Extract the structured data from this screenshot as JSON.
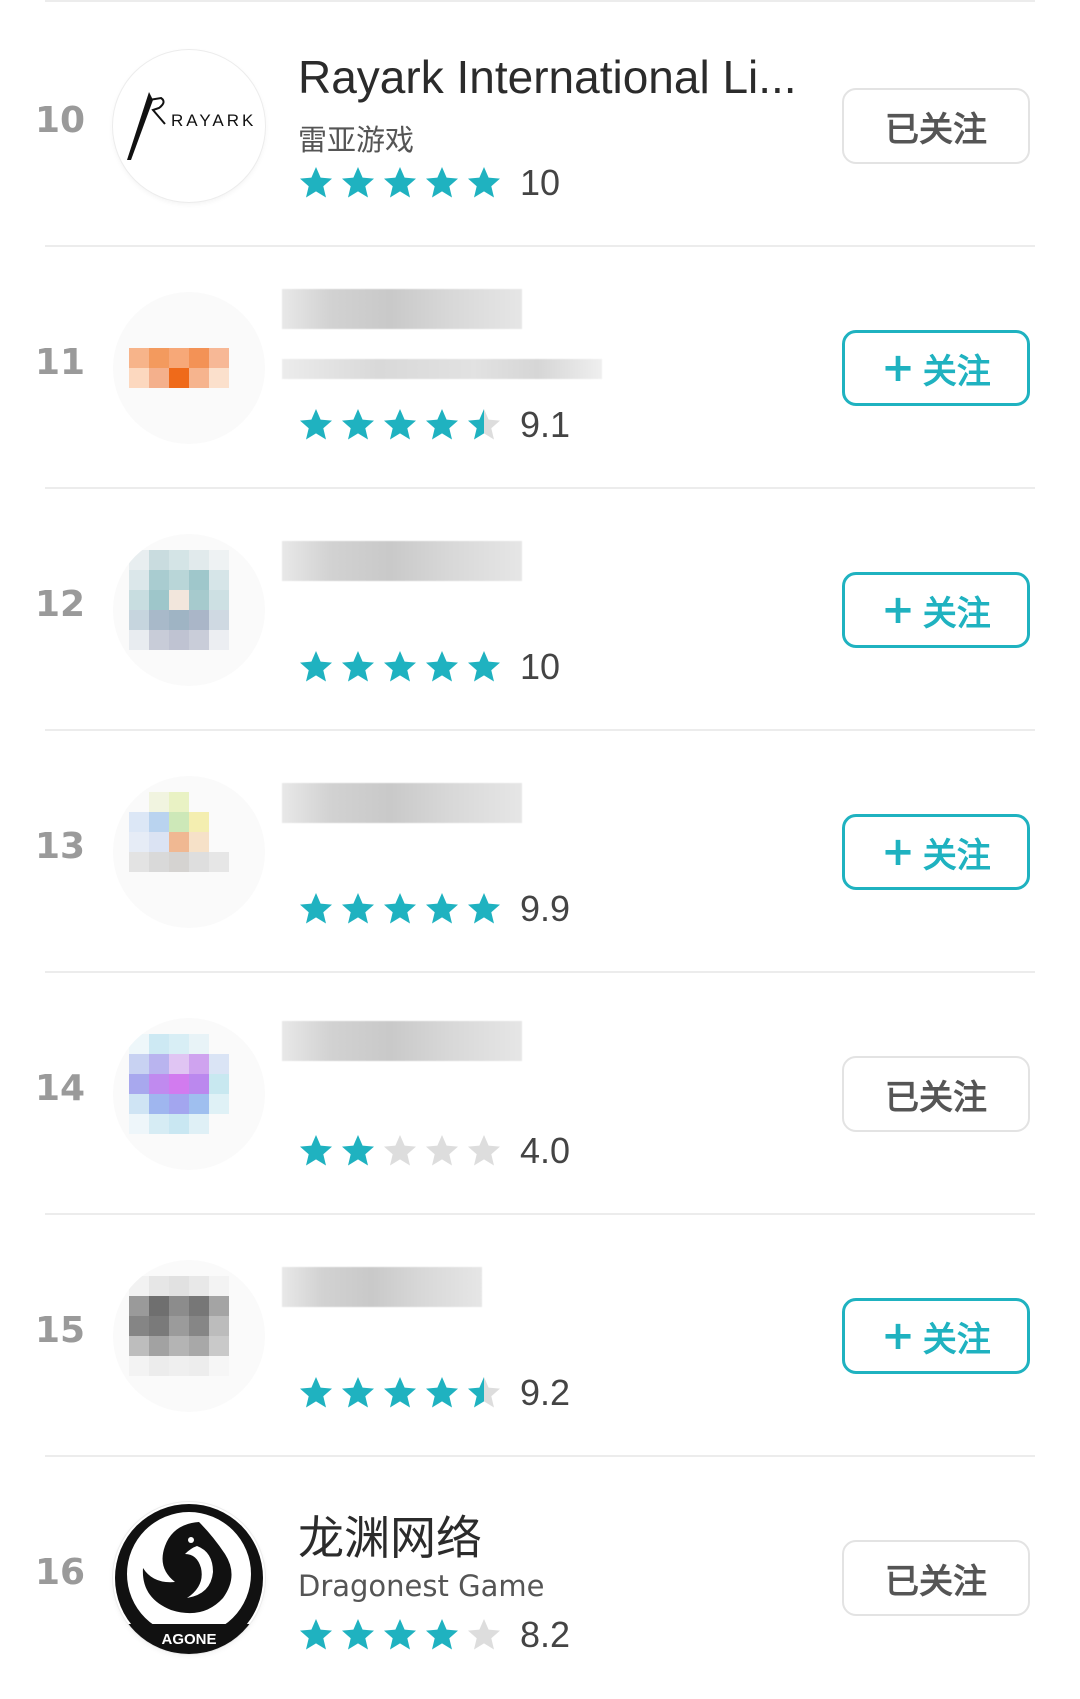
{
  "colors": {
    "accent": "#1fb2c0",
    "star_empty": "#dddddd",
    "divider": "#ececec"
  },
  "list": {
    "rows": [
      {
        "rank": "10",
        "name": "Rayark International Li...",
        "subtitle": "雷亚游戏",
        "rating": 5.0,
        "rating_label": "10",
        "follow_label": "已关注",
        "followed": true,
        "avatar": "rayark-logo",
        "logo_text": "RAYARK",
        "blurred": false
      },
      {
        "rank": "11",
        "name": "",
        "subtitle": "",
        "rating": 4.5,
        "rating_label": "9.1",
        "follow_label": "关注",
        "followed": false,
        "avatar": "blurred-orange",
        "blurred": true
      },
      {
        "rank": "12",
        "name": "",
        "subtitle": "",
        "rating": 5.0,
        "rating_label": "10",
        "follow_label": "关注",
        "followed": false,
        "avatar": "blurred-teal",
        "blurred": true
      },
      {
        "rank": "13",
        "name": "",
        "subtitle": "",
        "rating": 5.0,
        "rating_label": "9.9",
        "follow_label": "关注",
        "followed": false,
        "avatar": "blurred-multicolor",
        "blurred": true
      },
      {
        "rank": "14",
        "name": "",
        "subtitle": "",
        "rating": 2.0,
        "rating_label": "4.0",
        "follow_label": "已关注",
        "followed": true,
        "avatar": "blurred-purple",
        "blurred": true
      },
      {
        "rank": "15",
        "name": "",
        "subtitle": "",
        "rating": 4.5,
        "rating_label": "9.2",
        "follow_label": "关注",
        "followed": false,
        "avatar": "blurred-gray",
        "blurred": true
      },
      {
        "rank": "16",
        "name": "龙渊网络",
        "subtitle": "Dragonest Game",
        "rating": 4.0,
        "rating_label": "8.2",
        "follow_label": "已关注",
        "followed": true,
        "avatar": "dragonest-logo",
        "logo_text": "AGONE",
        "blurred": false
      }
    ]
  }
}
